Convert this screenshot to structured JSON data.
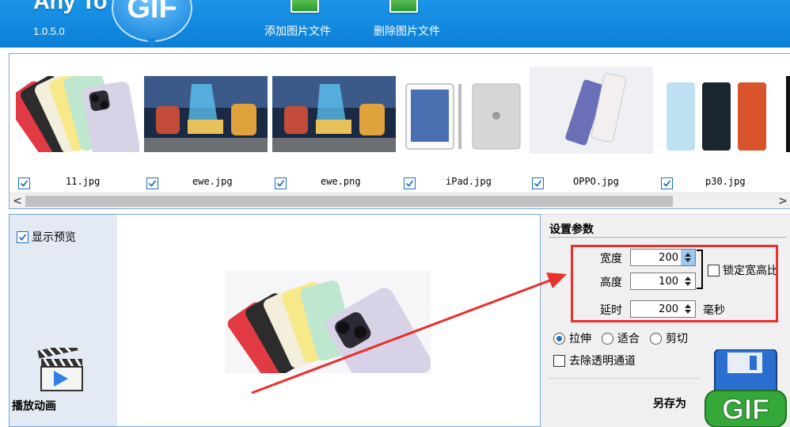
{
  "app": {
    "name": "Any To",
    "gif_word": "GIF",
    "version": "1.0.5.0"
  },
  "toolbar": {
    "add_label": "添加图片文件",
    "delete_label": "删除图片文件"
  },
  "thumbnails": [
    {
      "name": "11.jpg",
      "checked": true
    },
    {
      "name": "ewe.jpg",
      "checked": true
    },
    {
      "name": "ewe.png",
      "checked": true
    },
    {
      "name": "iPad.jpg",
      "checked": true
    },
    {
      "name": "OPPO.jpg",
      "checked": true
    },
    {
      "name": "p30.jpg",
      "checked": true
    }
  ],
  "scrollbar": {
    "left_arrow": "<",
    "right_arrow": ">"
  },
  "preview": {
    "show_preview_label": "显示预览",
    "show_preview_checked": true,
    "play_label": "播放动画"
  },
  "settings": {
    "title": "设置参数",
    "width_label": "宽度",
    "width_value": "200",
    "height_label": "高度",
    "height_value": "100",
    "lock_ratio_label": "锁定宽高比",
    "lock_ratio_checked": false,
    "delay_label": "延时",
    "delay_value": "200",
    "delay_unit": "毫秒",
    "modes": [
      {
        "label": "拉伸",
        "selected": true
      },
      {
        "label": "适合",
        "selected": false
      },
      {
        "label": "剪切",
        "selected": false
      }
    ],
    "remove_alpha_label": "去除透明通道",
    "remove_alpha_checked": false,
    "save_as_label": "另存为",
    "save_gif_word": "GIF"
  },
  "colors": {
    "header_blue": "#1b95e8",
    "accent_blue": "#1e6fc4",
    "highlight_red": "#e8302c",
    "save_green": "#35a83a"
  }
}
